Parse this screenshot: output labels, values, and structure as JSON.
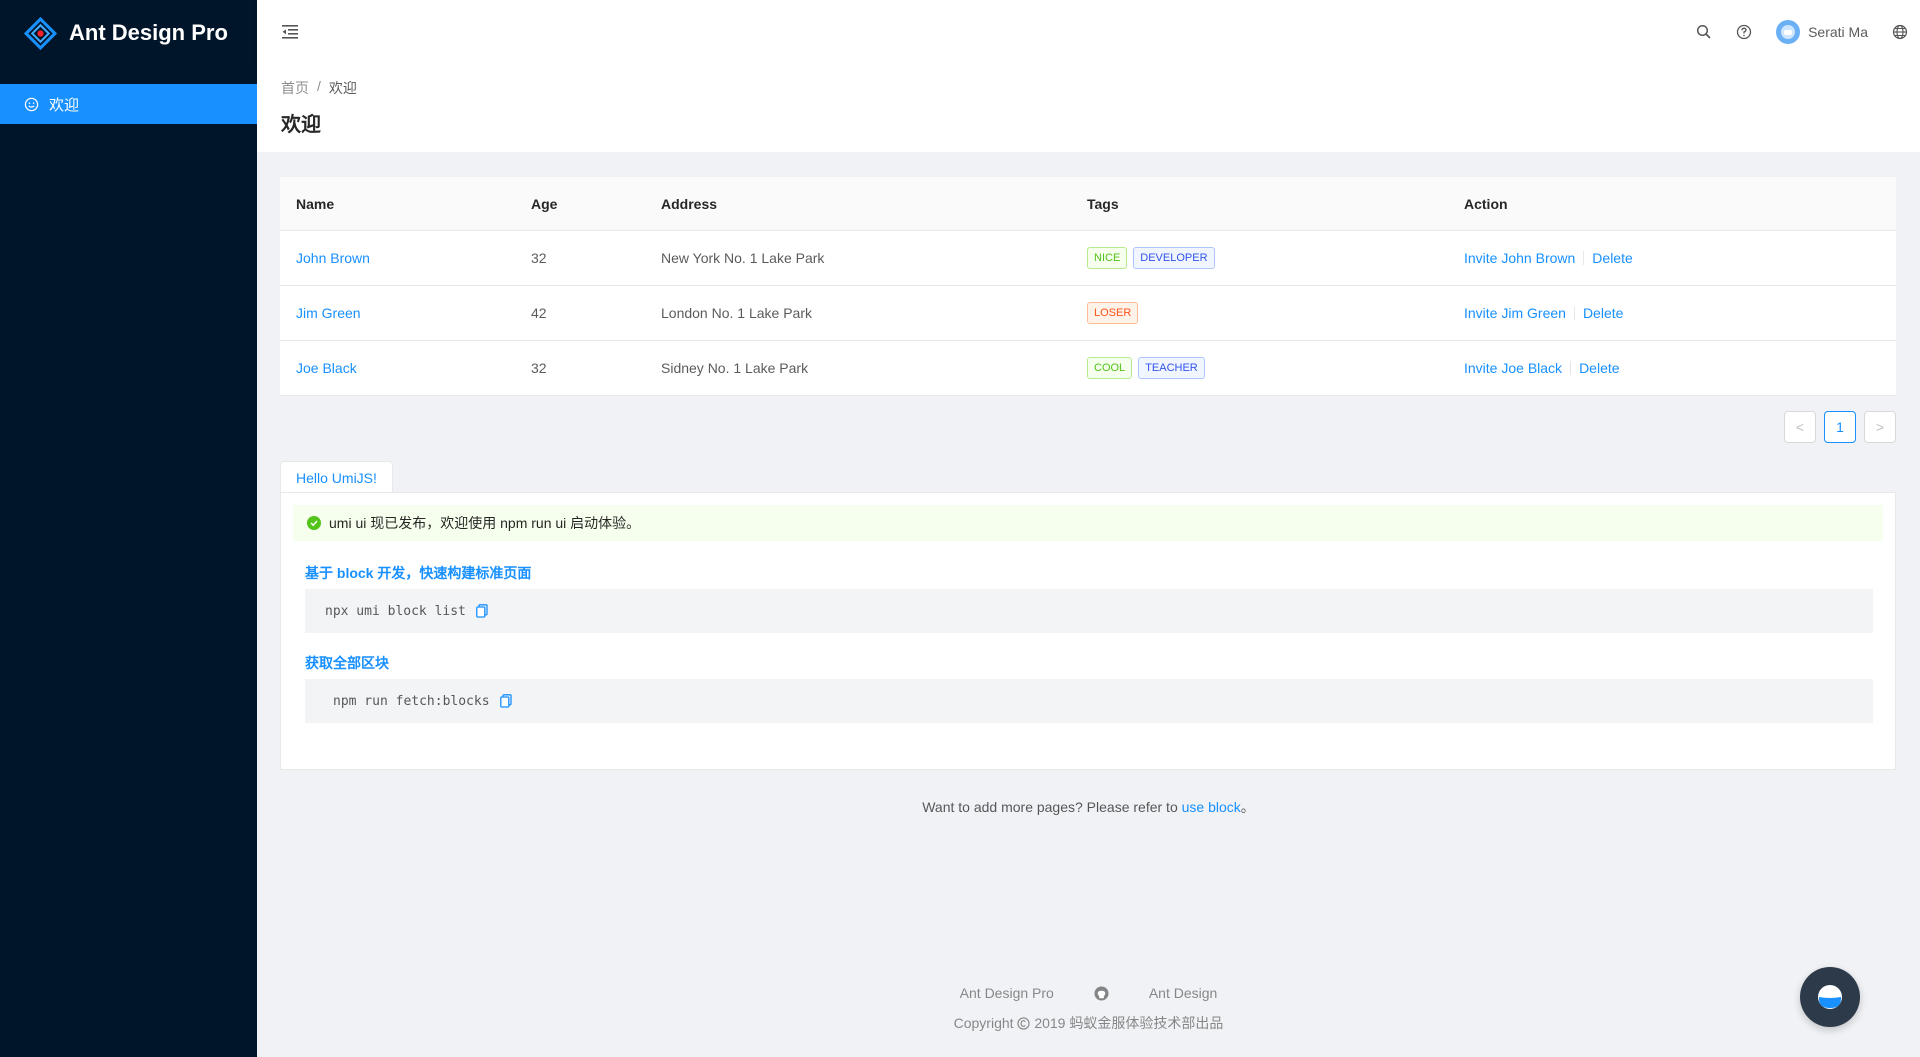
{
  "app": {
    "title": "Ant Design Pro"
  },
  "sidebar": {
    "items": [
      {
        "label": "欢迎",
        "icon": "smile-icon"
      }
    ]
  },
  "header": {
    "username": "Serati Ma"
  },
  "breadcrumb": [
    "首页",
    "/",
    "欢迎"
  ],
  "page": {
    "title": "欢迎"
  },
  "table": {
    "columns": [
      "Name",
      "Age",
      "Address",
      "Tags",
      "Action"
    ],
    "rows": [
      {
        "name": "John Brown",
        "age": "32",
        "address": "New York No. 1 Lake Park",
        "tags": [
          "NICE",
          "DEVELOPER"
        ],
        "invite": "Invite John Brown",
        "delete": "Delete"
      },
      {
        "name": "Jim Green",
        "age": "42",
        "address": "London No. 1 Lake Park",
        "tags": [
          "LOSER"
        ],
        "invite": "Invite Jim Green",
        "delete": "Delete"
      },
      {
        "name": "Joe Black",
        "age": "32",
        "address": "Sidney No. 1 Lake Park",
        "tags": [
          "COOL",
          "TEACHER"
        ],
        "invite": "Invite Joe Black",
        "delete": "Delete"
      }
    ]
  },
  "pagination": {
    "current": "1",
    "prev": "<",
    "next": ">"
  },
  "card": {
    "tab": "Hello UmiJS!",
    "alert": "umi ui 现已发布，欢迎使用 npm run ui 启动体验。",
    "section1": {
      "title": "基于 block 开发，快速构建标准页面",
      "code": "npx umi block list"
    },
    "section2": {
      "title": "获取全部区块",
      "code": "npm run fetch:blocks"
    }
  },
  "tip": {
    "text": "Want to add more pages? Please refer to ",
    "link": "use block",
    "suffix": "。"
  },
  "footer": {
    "links": [
      "Ant Design Pro",
      "Ant Design"
    ],
    "copyright_prefix": "Copyright",
    "copyright_text": "2019 蚂蚁金服体验技术部出品"
  },
  "colors": {
    "primary": "#1890ff",
    "sider": "#001529",
    "success": "#52c41a"
  }
}
